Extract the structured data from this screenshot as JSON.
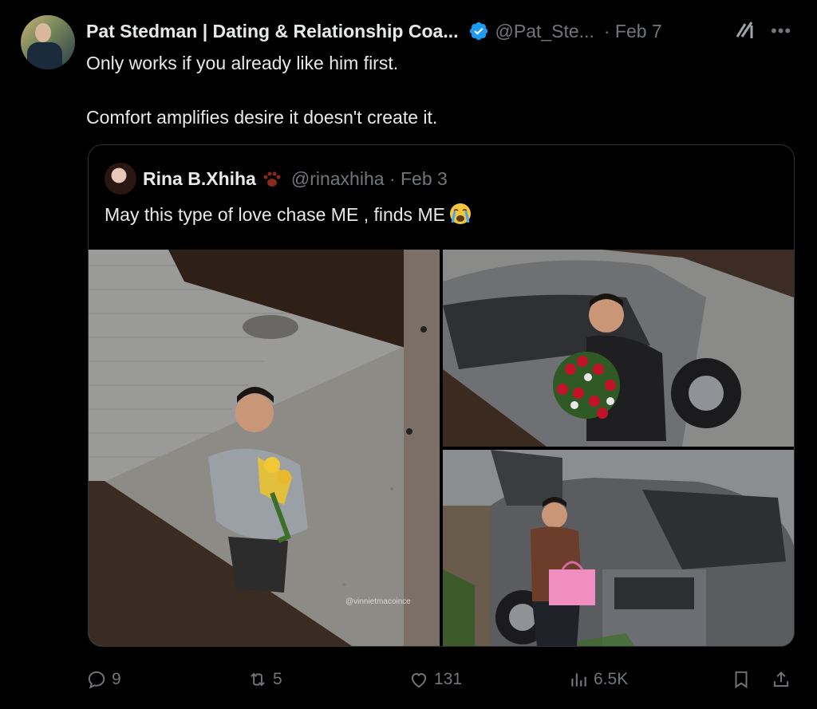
{
  "tweet": {
    "author_name": "Pat Stedman | Dating & Relationship Coa...",
    "author_handle": "@Pat_Ste...",
    "date": "· Feb 7",
    "lines": [
      "Only works if you already like him first.",
      "Comfort amplifies desire it doesn't create it."
    ]
  },
  "quote": {
    "author_name": "Rina B.Xhiha",
    "author_handle": "@rinaxhiha · Feb 3",
    "text": "May this type of love chase ME , finds ME",
    "watermark": "@vinnietmacoince"
  },
  "actions": {
    "replies": "9",
    "retweets": "5",
    "likes": "131",
    "views": "6.5K"
  },
  "colors": {
    "background": "#000000",
    "text": "#e7e9ea",
    "muted": "#71767b",
    "verified": "#1d9bf0",
    "border": "#2f3336"
  },
  "icons": [
    "verified-badge-icon",
    "grok-icon",
    "more-icon",
    "paw-icon",
    "crying-emoji-icon",
    "reply-icon",
    "retweet-icon",
    "like-icon",
    "views-icon",
    "bookmark-icon",
    "share-icon"
  ]
}
